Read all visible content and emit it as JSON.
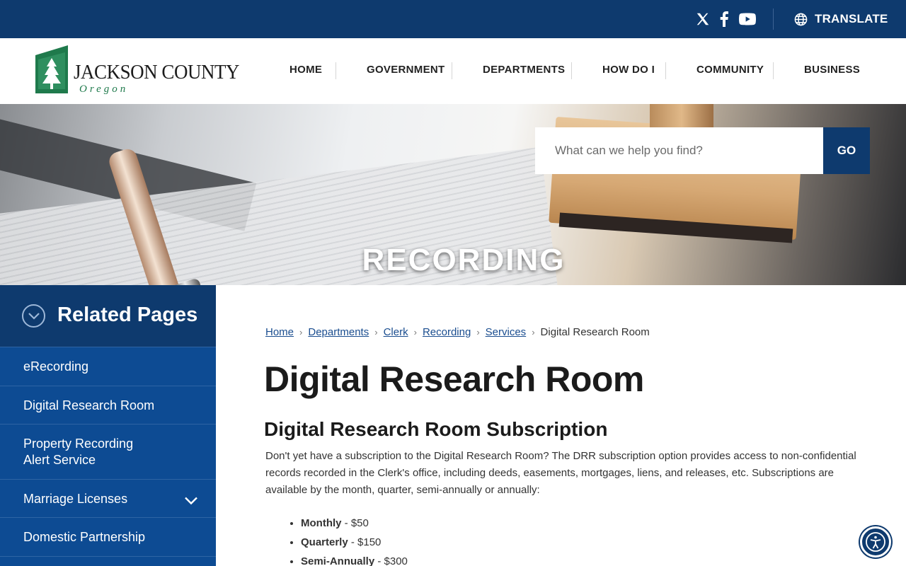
{
  "topbar": {
    "social": [
      "x-icon",
      "facebook-icon",
      "youtube-icon"
    ],
    "translate_label": "TRANSLATE"
  },
  "header": {
    "logo_name": "JACKSON COUNTY",
    "logo_sub": "Oregon",
    "nav": [
      "HOME",
      "GOVERNMENT",
      "DEPARTMENTS",
      "HOW DO I",
      "COMMUNITY",
      "BUSINESS"
    ]
  },
  "hero": {
    "title": "RECORDING",
    "search_placeholder": "What can we help you find?",
    "search_button": "GO"
  },
  "sidebar": {
    "title": "Related Pages",
    "items": [
      "eRecording",
      "Digital Research Room",
      "Property Recording",
      "Alert Service",
      "Marriage Licenses",
      "Domestic Partnership"
    ]
  },
  "breadcrumb": {
    "links": [
      "Home",
      "Departments",
      "Clerk",
      "Recording",
      "Services"
    ],
    "current": "Digital Research Room"
  },
  "main": {
    "title": "Digital Research Room",
    "subtitle": "Digital Research Room Subscription",
    "body": "Don't yet have a subscription to the Digital Research Room? The DRR subscription option provides access to non-confidential records recorded in the Clerk's office, including deeds, easements, mortgages, liens, and releases, etc. Subscriptions are available by the month, quarter, semi-annually or annually:",
    "prices": [
      {
        "term": "Monthly",
        "price": " - $50"
      },
      {
        "term": "Quarterly",
        "price": " - $150"
      },
      {
        "term": "Semi-Annually",
        "price": " - $300"
      }
    ]
  },
  "colors": {
    "navy": "#0e3a6e",
    "sidebar_blue": "#0d4b93",
    "link": "#1a4d8f",
    "logo_green": "#1f7a4c"
  }
}
